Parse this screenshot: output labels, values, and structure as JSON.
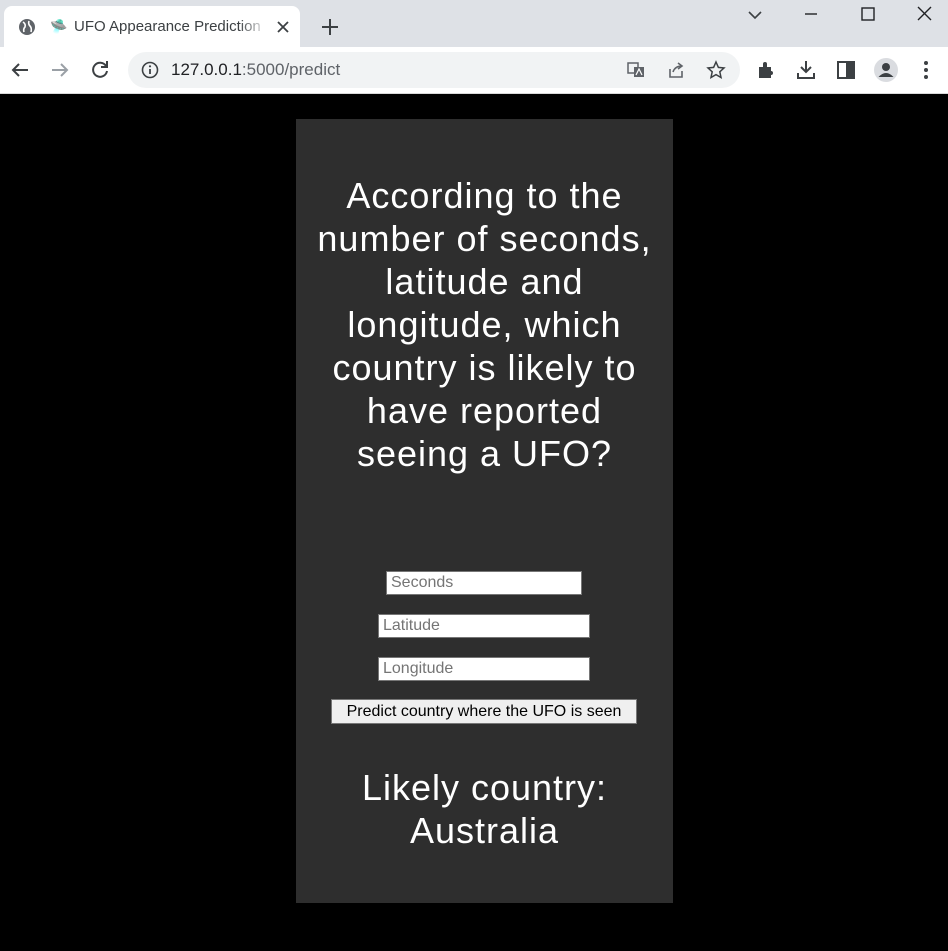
{
  "browser": {
    "tab": {
      "title": "UFO Appearance Prediction",
      "favicon": "globe-icon",
      "page_icon": "🛸"
    },
    "address": {
      "host": "127.0.0.1",
      "path": ":5000/predict"
    }
  },
  "page": {
    "heading": "According to the number of seconds, latitude and longitude, which country is likely to have reported seeing a UFO?",
    "form": {
      "seconds_placeholder": "Seconds",
      "latitude_placeholder": "Latitude",
      "longitude_placeholder": "Longitude",
      "submit_label": "Predict country where the UFO is seen"
    },
    "result": "Likely country: Australia"
  },
  "colors": {
    "page_background": "#000000",
    "card_background": "#2e2e2e",
    "text": "#ffffff"
  }
}
